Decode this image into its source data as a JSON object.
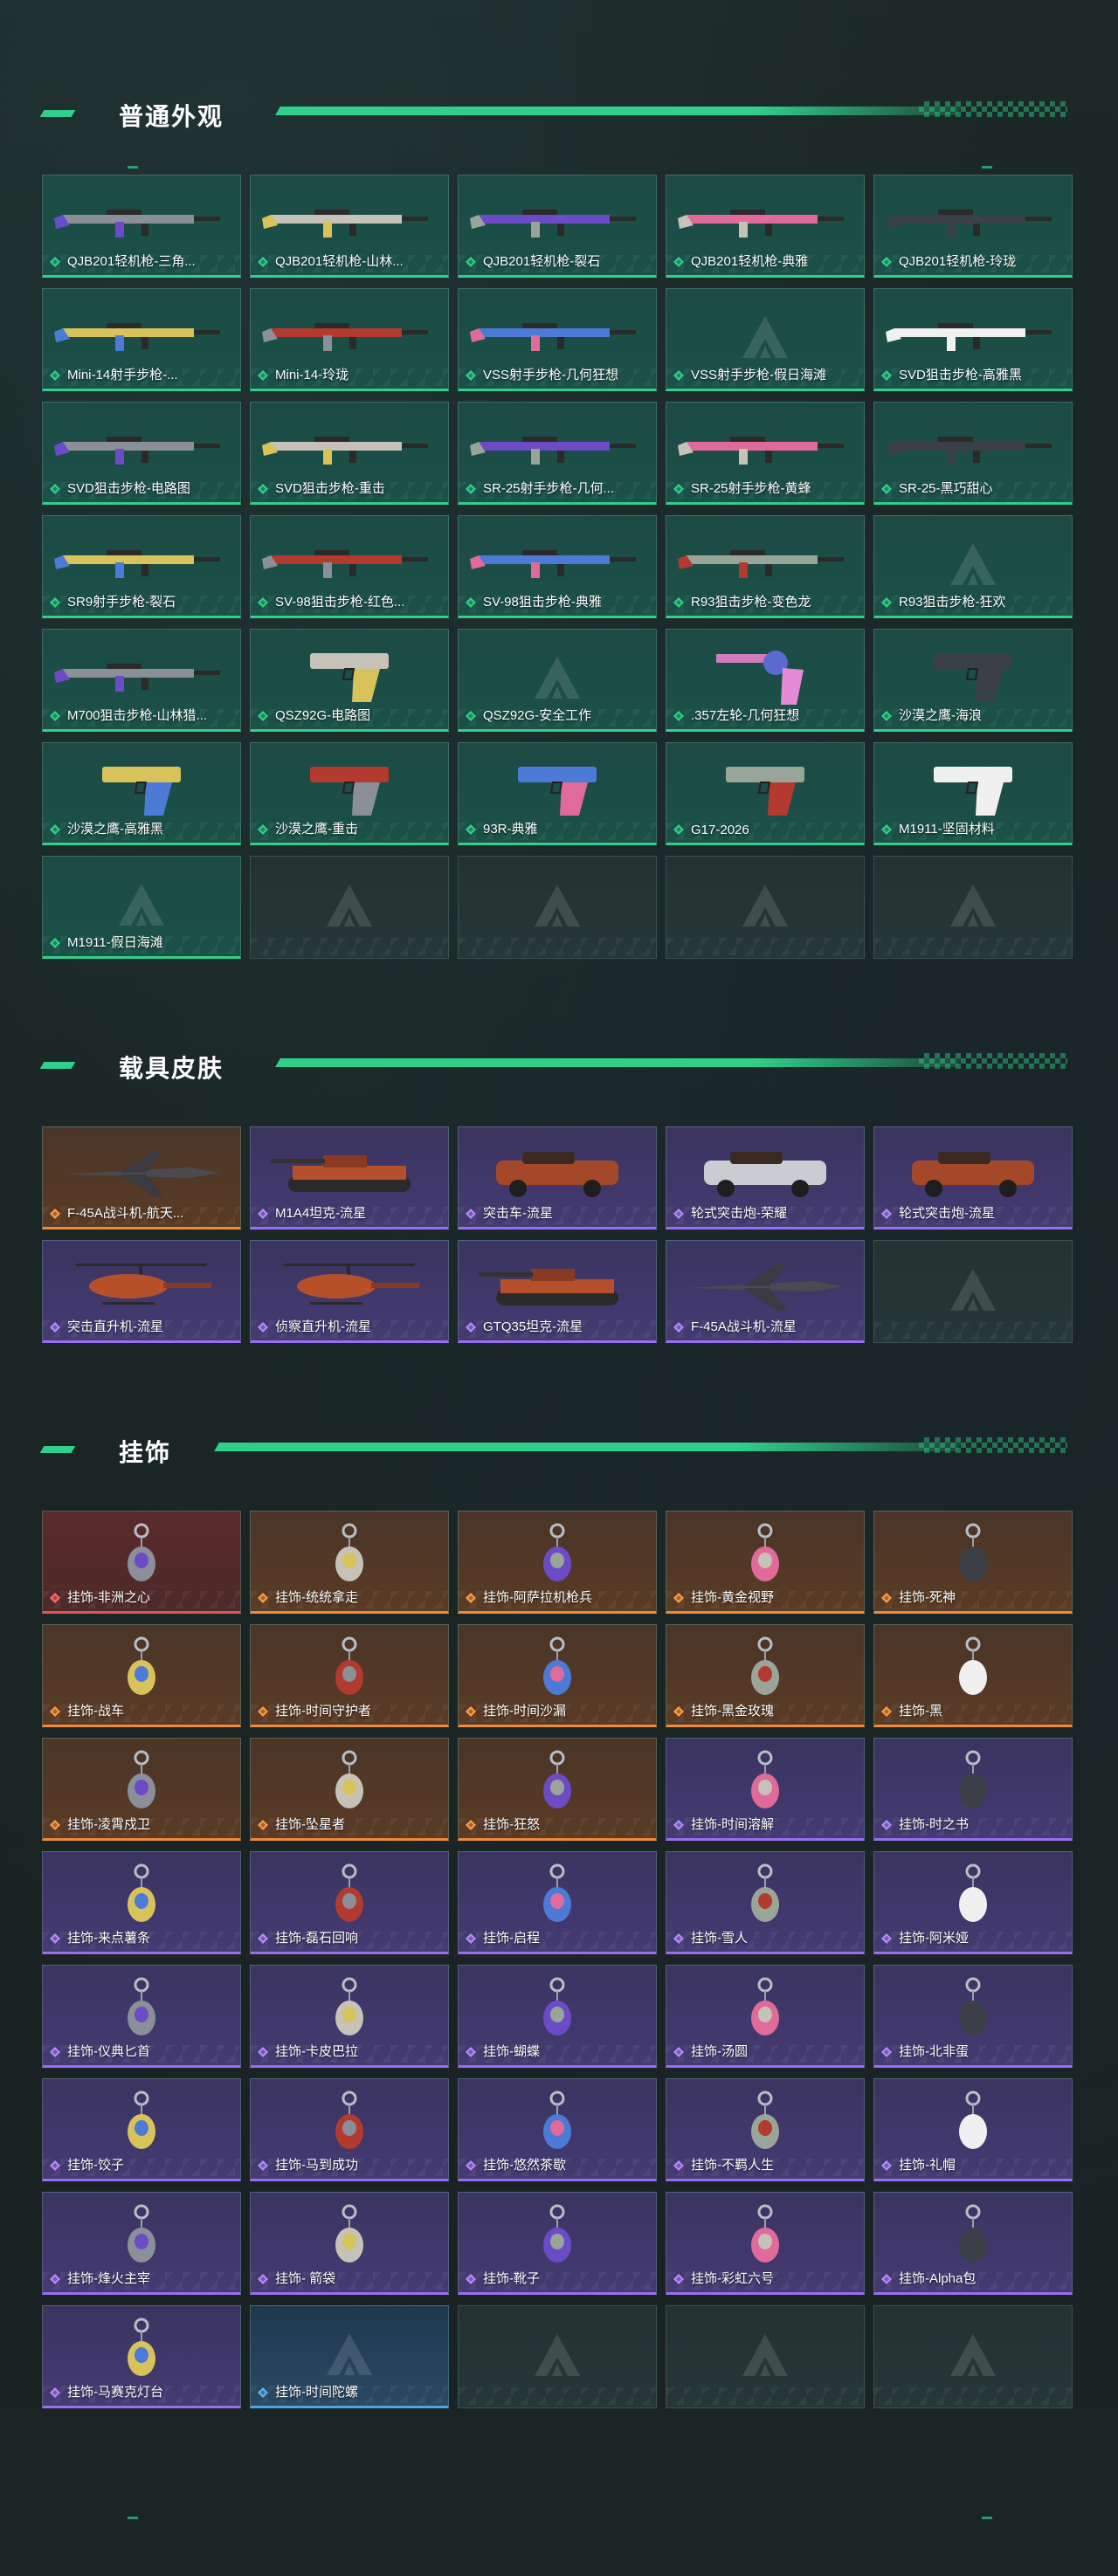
{
  "colors": {
    "accent": "#2fd08b",
    "weapon_card": "#1d4a45",
    "purple_card": "#3e3768",
    "orange_card": "#55392a",
    "red_card": "#5a2a2c",
    "blue_card": "#24405a"
  },
  "sections": {
    "weapons": {
      "title": "普通外观",
      "items": [
        {
          "label": "QJB201轻机枪-三角...",
          "rarity": "weapon",
          "icon": "rifle-icon"
        },
        {
          "label": "QJB201轻机枪-山林...",
          "rarity": "weapon",
          "icon": "rifle-icon"
        },
        {
          "label": "QJB201轻机枪-裂石",
          "rarity": "weapon",
          "icon": "rifle-icon"
        },
        {
          "label": "QJB201轻机枪-典雅",
          "rarity": "weapon",
          "icon": "rifle-icon"
        },
        {
          "label": "QJB201轻机枪-玲珑",
          "rarity": "weapon",
          "icon": "rifle-icon"
        },
        {
          "label": "Mini-14射手步枪-...",
          "rarity": "weapon",
          "icon": "rifle-icon"
        },
        {
          "label": "Mini-14-玲珑",
          "rarity": "weapon",
          "icon": "rifle-icon"
        },
        {
          "label": "VSS射手步枪-几何狂想",
          "rarity": "weapon",
          "icon": "rifle-icon"
        },
        {
          "label": "VSS射手步枪-假日海滩",
          "rarity": "weapon",
          "icon": ""
        },
        {
          "label": "SVD狙击步枪-高雅黑",
          "rarity": "weapon",
          "icon": "rifle-icon"
        },
        {
          "label": "SVD狙击步枪-电路图",
          "rarity": "weapon",
          "icon": "rifle-icon"
        },
        {
          "label": "SVD狙击步枪-重击",
          "rarity": "weapon",
          "icon": "rifle-icon"
        },
        {
          "label": "SR-25射手步枪-几何...",
          "rarity": "weapon",
          "icon": "rifle-icon"
        },
        {
          "label": "SR-25射手步枪-黄蜂",
          "rarity": "weapon",
          "icon": "rifle-icon"
        },
        {
          "label": "SR-25-黑巧甜心",
          "rarity": "weapon",
          "icon": "rifle-icon"
        },
        {
          "label": "SR9射手步枪-裂石",
          "rarity": "weapon",
          "icon": "rifle-icon"
        },
        {
          "label": "SV-98狙击步枪-红色...",
          "rarity": "weapon",
          "icon": "rifle-icon"
        },
        {
          "label": "SV-98狙击步枪-典雅",
          "rarity": "weapon",
          "icon": "rifle-icon"
        },
        {
          "label": "R93狙击步枪-变色龙",
          "rarity": "weapon",
          "icon": "rifle-icon"
        },
        {
          "label": "R93狙击步枪-狂欢",
          "rarity": "weapon",
          "icon": ""
        },
        {
          "label": "M700狙击步枪-山林猎...",
          "rarity": "weapon",
          "icon": "rifle-icon"
        },
        {
          "label": "QSZ92G-电路图",
          "rarity": "weapon",
          "icon": "pistol-icon"
        },
        {
          "label": "QSZ92G-安全工作",
          "rarity": "weapon",
          "icon": ""
        },
        {
          "label": ".357左轮-几何狂想",
          "rarity": "weapon",
          "icon": "revolver-icon"
        },
        {
          "label": "沙漠之鹰-海浪",
          "rarity": "weapon",
          "icon": "pistol-icon"
        },
        {
          "label": "沙漠之鹰-高雅黑",
          "rarity": "weapon",
          "icon": "pistol-icon"
        },
        {
          "label": "沙漠之鹰-重击",
          "rarity": "weapon",
          "icon": "pistol-icon"
        },
        {
          "label": "93R-典雅",
          "rarity": "weapon",
          "icon": "pistol-icon"
        },
        {
          "label": "G17-2026",
          "rarity": "weapon",
          "icon": "pistol-icon"
        },
        {
          "label": "M1911-坚固材料",
          "rarity": "weapon",
          "icon": "pistol-icon"
        },
        {
          "label": "M1911-假日海滩",
          "rarity": "weapon",
          "icon": ""
        },
        {
          "label": "",
          "rarity": "empty",
          "icon": ""
        },
        {
          "label": "",
          "rarity": "empty",
          "icon": ""
        },
        {
          "label": "",
          "rarity": "empty",
          "icon": ""
        },
        {
          "label": "",
          "rarity": "empty",
          "icon": ""
        }
      ]
    },
    "vehicles": {
      "title": "载具皮肤",
      "items": [
        {
          "label": "F-45A战斗机-航天...",
          "rarity": "orange",
          "icon": "jet-icon"
        },
        {
          "label": "M1A4坦克-流星",
          "rarity": "purple",
          "icon": "tank-icon"
        },
        {
          "label": "突击车-流星",
          "rarity": "purple",
          "icon": "truck-icon"
        },
        {
          "label": "轮式突击炮-荣耀",
          "rarity": "purple",
          "icon": "truck-icon"
        },
        {
          "label": "轮式突击炮-流星",
          "rarity": "purple",
          "icon": "truck-icon"
        },
        {
          "label": "突击直升机-流星",
          "rarity": "purple",
          "icon": "helicopter-icon"
        },
        {
          "label": "侦察直升机-流星",
          "rarity": "purple",
          "icon": "helicopter-icon"
        },
        {
          "label": "GTQ35坦克-流星",
          "rarity": "purple",
          "icon": "tank-icon"
        },
        {
          "label": "F-45A战斗机-流星",
          "rarity": "purple",
          "icon": "jet-icon"
        },
        {
          "label": "",
          "rarity": "empty",
          "icon": ""
        }
      ]
    },
    "charms": {
      "title": "挂饰",
      "items": [
        {
          "label": "挂饰-非洲之心",
          "rarity": "red",
          "icon": "charm-icon"
        },
        {
          "label": "挂饰-统统拿走",
          "rarity": "orange",
          "icon": "charm-icon"
        },
        {
          "label": "挂饰-阿萨拉机枪兵",
          "rarity": "orange",
          "icon": "charm-icon"
        },
        {
          "label": "挂饰-黄金视野",
          "rarity": "orange",
          "icon": "charm-icon"
        },
        {
          "label": "挂饰-死神",
          "rarity": "orange",
          "icon": "charm-icon"
        },
        {
          "label": "挂饰-战车",
          "rarity": "orange",
          "icon": "charm-icon"
        },
        {
          "label": "挂饰-时间守护者",
          "rarity": "orange",
          "icon": "charm-icon"
        },
        {
          "label": "挂饰-时间沙漏",
          "rarity": "orange",
          "icon": "charm-icon"
        },
        {
          "label": "挂饰-黑金玫瑰",
          "rarity": "orange",
          "icon": "charm-icon"
        },
        {
          "label": "挂饰-黑",
          "rarity": "orange",
          "icon": "charm-icon"
        },
        {
          "label": "挂饰-凌霄戍卫",
          "rarity": "orange",
          "icon": "charm-icon"
        },
        {
          "label": "挂饰-坠星者",
          "rarity": "orange",
          "icon": "charm-icon"
        },
        {
          "label": "挂饰-狂怒",
          "rarity": "orange",
          "icon": "charm-icon"
        },
        {
          "label": "挂饰-时间溶解",
          "rarity": "purple",
          "icon": "charm-icon"
        },
        {
          "label": "挂饰-时之书",
          "rarity": "purple",
          "icon": "charm-icon"
        },
        {
          "label": "挂饰-来点薯条",
          "rarity": "purple",
          "icon": "charm-icon"
        },
        {
          "label": "挂饰-磊石回响",
          "rarity": "purple",
          "icon": "charm-icon"
        },
        {
          "label": "挂饰-启程",
          "rarity": "purple",
          "icon": "charm-icon"
        },
        {
          "label": "挂饰-雪人",
          "rarity": "purple",
          "icon": "charm-icon"
        },
        {
          "label": "挂饰-阿米娅",
          "rarity": "purple",
          "icon": "charm-icon"
        },
        {
          "label": "挂饰-仪典匕首",
          "rarity": "purple",
          "icon": "charm-icon"
        },
        {
          "label": "挂饰-卡皮巴拉",
          "rarity": "purple",
          "icon": "charm-icon"
        },
        {
          "label": "挂饰-蝴蝶",
          "rarity": "purple",
          "icon": "charm-icon"
        },
        {
          "label": "挂饰-汤圆",
          "rarity": "purple",
          "icon": "charm-icon"
        },
        {
          "label": "挂饰-北非蛋",
          "rarity": "purple",
          "icon": "charm-icon"
        },
        {
          "label": "挂饰-饺子",
          "rarity": "purple",
          "icon": "charm-icon"
        },
        {
          "label": "挂饰-马到成功",
          "rarity": "purple",
          "icon": "charm-icon"
        },
        {
          "label": "挂饰-悠然茶歇",
          "rarity": "purple",
          "icon": "charm-icon"
        },
        {
          "label": "挂饰-不羁人生",
          "rarity": "purple",
          "icon": "charm-icon"
        },
        {
          "label": "挂饰-礼帽",
          "rarity": "purple",
          "icon": "charm-icon"
        },
        {
          "label": "挂饰-烽火主宰",
          "rarity": "purple",
          "icon": "charm-icon"
        },
        {
          "label": "挂饰- 箭袋",
          "rarity": "purple",
          "icon": "charm-icon"
        },
        {
          "label": "挂饰-靴子",
          "rarity": "purple",
          "icon": "charm-icon"
        },
        {
          "label": "挂饰-彩虹六号",
          "rarity": "purple",
          "icon": "charm-icon"
        },
        {
          "label": "挂饰-Alpha包",
          "rarity": "purple",
          "icon": "charm-icon"
        },
        {
          "label": "挂饰-马赛克灯台",
          "rarity": "purple",
          "icon": "charm-icon"
        },
        {
          "label": "挂饰-时间陀螺",
          "rarity": "blue",
          "icon": ""
        },
        {
          "label": "",
          "rarity": "empty",
          "icon": ""
        },
        {
          "label": "",
          "rarity": "empty",
          "icon": ""
        },
        {
          "label": "",
          "rarity": "empty",
          "icon": ""
        }
      ]
    }
  }
}
